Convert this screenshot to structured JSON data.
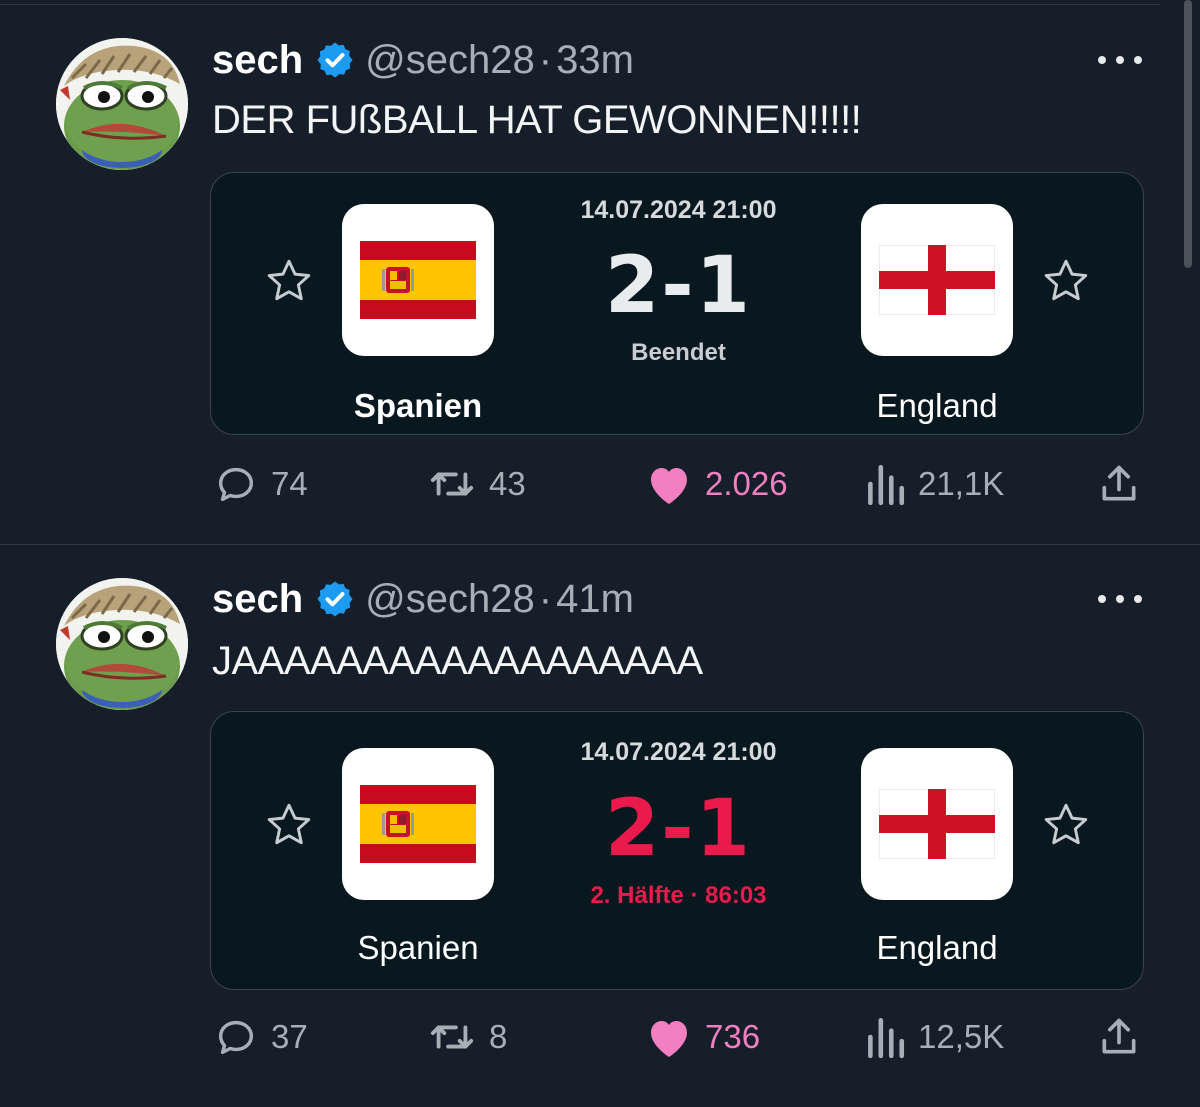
{
  "tweets": [
    {
      "author_name": "sech",
      "handle": "@sech28",
      "separator": "·",
      "time": "33m",
      "text": "DER FUßBALL HAT GEWONNEN!!!!!",
      "card": {
        "datetime": "14.07.2024 21:00",
        "score": "2-1",
        "score_color": "#e8ecef",
        "status": "Beendet",
        "status_color": "#c9cdd1",
        "home_team": "Spanien",
        "away_team": "England",
        "home_bold": true
      },
      "stats": {
        "replies": "74",
        "reposts": "43",
        "likes": "2.026",
        "views": "21,1K"
      }
    },
    {
      "author_name": "sech",
      "handle": "@sech28",
      "separator": "·",
      "time": "41m",
      "text": "JAAAAAAAAAAAAAAAAAA",
      "card": {
        "datetime": "14.07.2024 21:00",
        "score": "2-1",
        "score_color": "#ea1a4c",
        "status": "2. Hälfte · 86:03",
        "status_color": "#ea1a4c",
        "home_team": "Spanien",
        "away_team": "England",
        "home_bold": false
      },
      "stats": {
        "replies": "37",
        "reposts": "8",
        "likes": "736",
        "views": "12,5K"
      }
    }
  ],
  "colors": {
    "background": "#161e29",
    "verified": "#1d9bf0",
    "like": "#f27fbf",
    "muted": "#a8aeb5"
  },
  "icons": [
    "pepe-avatar",
    "verified-badge-icon",
    "more-icon",
    "star-icon",
    "spain-flag",
    "england-flag",
    "reply-icon",
    "repost-icon",
    "heart-icon",
    "views-icon",
    "share-icon"
  ]
}
